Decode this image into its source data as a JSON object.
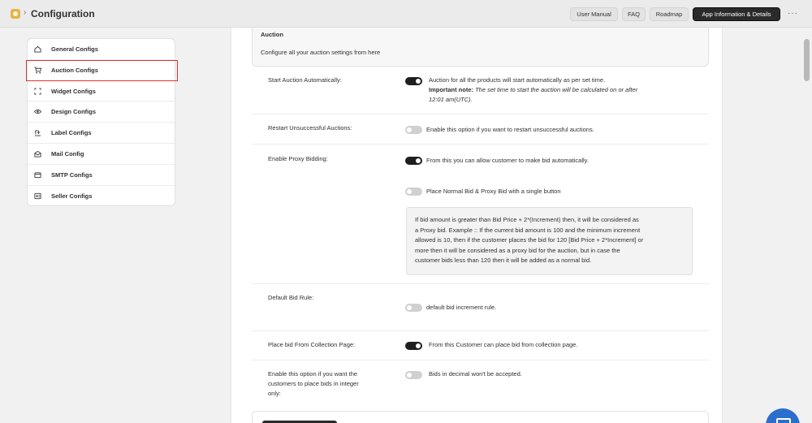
{
  "topbar": {
    "title": "Configuration",
    "buttons": [
      "User Manual",
      "FAQ",
      "Roadmap",
      "App Information & Details"
    ],
    "more": "···"
  },
  "sidebar": {
    "items": [
      {
        "label": "General Configs",
        "icon": "home-icon"
      },
      {
        "label": "Auction Configs",
        "icon": "cart-icon"
      },
      {
        "label": "Widget Configs",
        "icon": "widget-icon"
      },
      {
        "label": "Design Configs",
        "icon": "eye-icon"
      },
      {
        "label": "Label Configs",
        "icon": "label-icon"
      },
      {
        "label": "Mail Config",
        "icon": "mail-icon"
      },
      {
        "label": "SMTP Configs",
        "icon": "smtp-icon"
      },
      {
        "label": "Seller Configs",
        "icon": "seller-icon"
      }
    ],
    "active": "Auction Configs"
  },
  "section": {
    "title": "Auction",
    "description": "Configure all your auction settings from here"
  },
  "settings": {
    "start_auction": {
      "label": "Start Auction Automatically:",
      "enabled": true,
      "text": "Auction for all the products will start automatically as per set time.",
      "note_bold": "Important note:",
      "note_italic": " The set time to start the auction will be calculated on or after",
      "note_line2": "12:01 am(UTC)."
    },
    "restart_auctions": {
      "label": "Restart Unsuccessful Auctions:",
      "enabled": false,
      "text": "Enable this option if you want to restart unsuccessful auctions."
    },
    "proxy_bidding": {
      "label": "Enable Proxy Bidding:",
      "enabled": true,
      "text": "From this you can allow customer to make bid automatically.",
      "single_button_enabled": false,
      "single_button_text": "Place Normal Bid & Proxy Bid with a single button",
      "info_lines": [
        "If bid amount is greater than Bid Price + 2*(Increment) then, it will be considered as",
        "a Proxy bid. Example :: If the current bid amount is 100 and the minimum increment",
        "allowed is 10, then if the customer places the bid for 120 [Bid Price + 2*Increment] or",
        "more then it will be considered as a proxy bid for the auction, but in case the",
        "customer bids less than 120 then it will be added as a normal bid."
      ]
    },
    "default_bid_rule": {
      "label": "Default Bid Rule:",
      "enabled": false,
      "text": "default bid increment rule."
    },
    "collection_page": {
      "label": "Place bid From Collection Page:",
      "enabled": true,
      "text": "From this Customer can place bid from collection page."
    },
    "integer_bids": {
      "label_lines": [
        "Enable this option if you want the",
        "customers to place bids in integer",
        "only:"
      ],
      "enabled": false,
      "text": "Bids in decimal won't be accepted."
    }
  }
}
